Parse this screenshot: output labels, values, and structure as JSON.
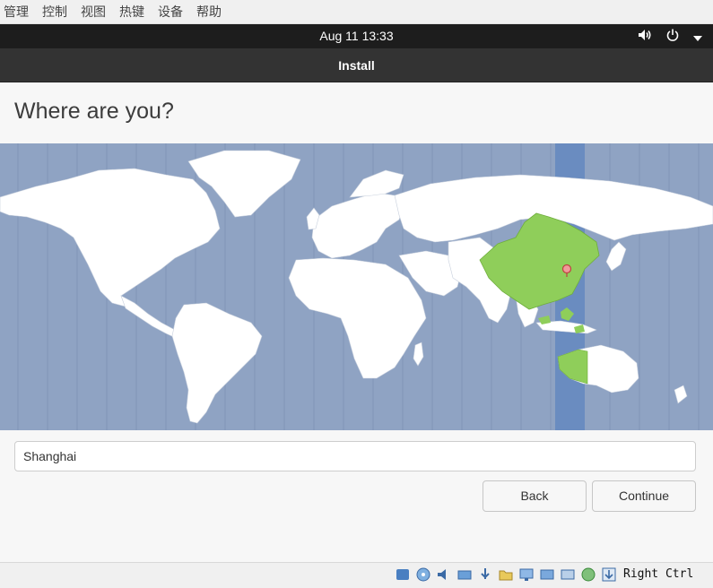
{
  "host_menu": [
    "管理",
    "控制",
    "视图",
    "热键",
    "设备",
    "帮助"
  ],
  "topbar": {
    "clock": "Aug 11  13:33",
    "icons": [
      "volume-icon",
      "power-icon",
      "chevron-down-icon"
    ]
  },
  "window": {
    "title": "Install"
  },
  "page": {
    "heading": "Where are you?",
    "timezone_value": "Shanghai",
    "selected_region": "China",
    "back_label": "Back",
    "continue_label": "Continue"
  },
  "statusbar": {
    "icons": [
      "storage-icon",
      "optical-drive-icon",
      "audio-icon",
      "network-icon",
      "usb-icon",
      "shared-folder-icon",
      "display-icon",
      "video-capture-icon",
      "recording-icon",
      "globe-icon",
      "download-icon"
    ],
    "host_key": "Right Ctrl"
  },
  "colors": {
    "ocean": "#8fa3c3",
    "land": "#ffffff",
    "selected_land": "#8fce5a",
    "selected_zone": "#6a8cc0",
    "topbar": "#1d1d1d",
    "titlebar": "#333333"
  }
}
